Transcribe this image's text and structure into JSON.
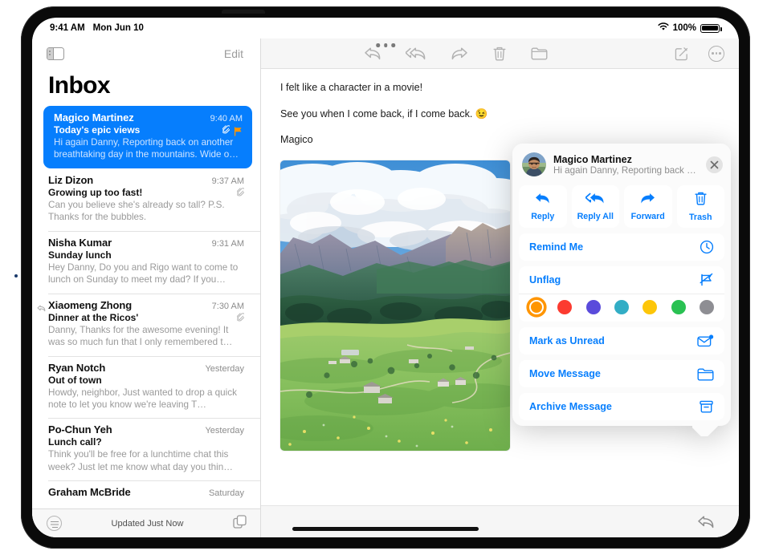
{
  "status_bar": {
    "time": "9:41 AM",
    "date": "Mon Jun 10",
    "battery_percent": "100%",
    "wifi_icon": "wifi-icon",
    "battery_icon": "battery-icon"
  },
  "mail_list": {
    "sidebar_toggle_icon": "sidebar-toggle-icon",
    "edit_label": "Edit",
    "title": "Inbox",
    "footer_status": "Updated Just Now",
    "filter_icon": "filter-icon",
    "copy_icon": "duplicate-icon",
    "messages": [
      {
        "sender": "Magico Martinez",
        "time": "9:40 AM",
        "subject": "Today's epic views",
        "preview": "Hi again Danny, Reporting back on another breathtaking day in the mountains. Wide o…",
        "selected": true,
        "has_attachment": true,
        "flagged": true,
        "replied": false
      },
      {
        "sender": "Liz Dizon",
        "time": "9:37 AM",
        "subject": "Growing up too fast!",
        "preview": "Can you believe she's already so tall? P.S. Thanks for the bubbles.",
        "selected": false,
        "has_attachment": true,
        "flagged": false,
        "replied": false
      },
      {
        "sender": "Nisha Kumar",
        "time": "9:31 AM",
        "subject": "Sunday lunch",
        "preview": "Hey Danny, Do you and Rigo want to come to lunch on Sunday to meet my dad? If you…",
        "selected": false,
        "has_attachment": false,
        "flagged": false,
        "replied": false
      },
      {
        "sender": "Xiaomeng Zhong",
        "time": "7:30 AM",
        "subject": "Dinner at the Ricos'",
        "preview": "Danny, Thanks for the awesome evening! It was so much fun that I only remembered t…",
        "selected": false,
        "has_attachment": true,
        "flagged": false,
        "replied": true
      },
      {
        "sender": "Ryan Notch",
        "time": "Yesterday",
        "subject": "Out of town",
        "preview": "Howdy, neighbor, Just wanted to drop a quick note to let you know we're leaving T…",
        "selected": false,
        "has_attachment": false,
        "flagged": false,
        "replied": false
      },
      {
        "sender": "Po-Chun Yeh",
        "time": "Yesterday",
        "subject": "Lunch call?",
        "preview": "Think you'll be free for a lunchtime chat this week? Just let me know what day you thin…",
        "selected": false,
        "has_attachment": false,
        "flagged": false,
        "replied": false
      },
      {
        "sender": "Graham McBride",
        "time": "Saturday",
        "subject": "",
        "preview": "",
        "selected": false,
        "has_attachment": false,
        "flagged": false,
        "replied": false
      }
    ]
  },
  "detail": {
    "toolbar": {
      "reply_icon": "reply-icon",
      "reply_all_icon": "reply-all-icon",
      "forward_icon": "forward-icon",
      "trash_icon": "trash-icon",
      "folder_icon": "folder-icon",
      "compose_icon": "compose-icon",
      "more_icon": "more-icon"
    },
    "body_paragraphs": [
      "I felt like a character in a movie!",
      "See you when I come back, if I come back. 😉",
      "Magico"
    ],
    "photo_alt": "mountain-meadow-photo",
    "bottom_reply_icon": "reply-icon"
  },
  "context_popup": {
    "sender_name": "Magico Martinez",
    "snippet": "Hi again Danny, Reporting back o…",
    "avatar_icon": "avatar",
    "close_icon": "close-icon",
    "actions": [
      {
        "label": "Reply",
        "icon": "reply-icon"
      },
      {
        "label": "Reply All",
        "icon": "reply-all-icon"
      },
      {
        "label": "Forward",
        "icon": "forward-icon"
      },
      {
        "label": "Trash",
        "icon": "trash-icon"
      }
    ],
    "remind_me": {
      "label": "Remind Me",
      "icon": "clock-icon"
    },
    "unflag": {
      "label": "Unflag",
      "icon": "flag-slash-icon"
    },
    "flag_colors": [
      {
        "name": "orange",
        "hex": "#FF9500",
        "selected": true
      },
      {
        "name": "red",
        "hex": "#FC3B30",
        "selected": false
      },
      {
        "name": "purple",
        "hex": "#5A4BDB",
        "selected": false
      },
      {
        "name": "teal",
        "hex": "#32ADC5",
        "selected": false
      },
      {
        "name": "yellow",
        "hex": "#FDC609",
        "selected": false
      },
      {
        "name": "green",
        "hex": "#29C152",
        "selected": false
      },
      {
        "name": "gray",
        "hex": "#8E8E93",
        "selected": false
      }
    ],
    "mark_unread": {
      "label": "Mark as Unread",
      "icon": "envelope-badge-icon"
    },
    "move_message": {
      "label": "Move Message",
      "icon": "folder-icon"
    },
    "archive_message": {
      "label": "Archive Message",
      "icon": "archive-box-icon"
    }
  },
  "theme": {
    "accent_blue": "#067efd",
    "selected_row_blue": "#067efd",
    "flag_orange": "#FF9500",
    "muted_gray": "#9a9a9a"
  }
}
